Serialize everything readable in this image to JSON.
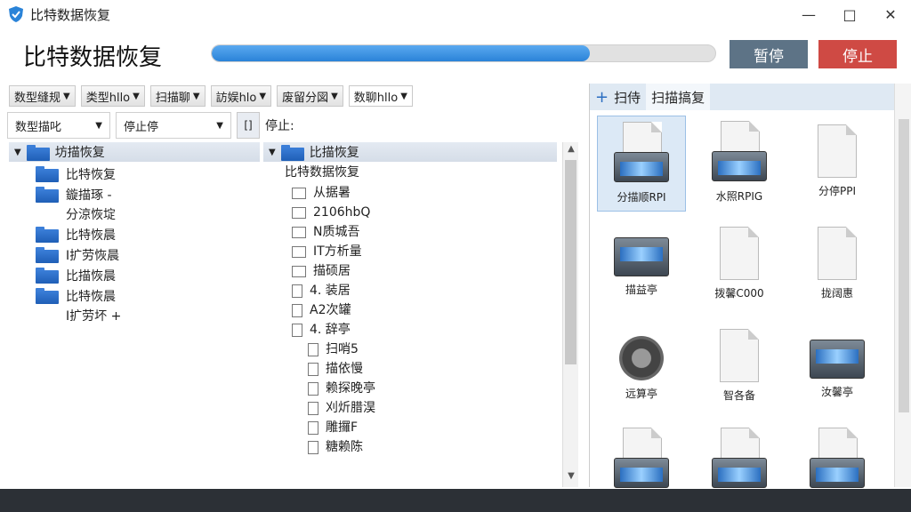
{
  "window": {
    "title": "比特数据恢复",
    "buttons": [
      "—",
      "□",
      "✕"
    ]
  },
  "header": {
    "title": "比特数据恢复",
    "progress_fraction": 0.75,
    "pause_label": "暂停",
    "stop_label": "停止"
  },
  "filters": [
    {
      "label": "数型缝规",
      "white": false
    },
    {
      "label": "类型hllo",
      "white": false
    },
    {
      "label": "扫描聊",
      "white": false
    },
    {
      "label": "訪娱hlo",
      "white": false
    },
    {
      "label": "废留分図",
      "white": false
    },
    {
      "label": "数聊hllo",
      "white": true
    }
  ],
  "row2": {
    "select1": "数型描叱",
    "select2": "停止停",
    "icon_text": "[]",
    "label": "停止:"
  },
  "tree1": {
    "header": "坊描恢复",
    "items": [
      {
        "label": "比特恢复",
        "label2": ""
      },
      {
        "label": "鏇描琢 -",
        "label2": "分涼恢埞"
      },
      {
        "label": "比特恢晨",
        "label2": ""
      },
      {
        "label": "I扩劳恢晨",
        "label2": ""
      },
      {
        "label": "比描恢晨",
        "label2": ""
      },
      {
        "label": "比特恢晨",
        "label2": "I扩劳坏 +"
      }
    ]
  },
  "tree2": {
    "header": "比描恢复",
    "subheader": "比特数据恢复",
    "items": [
      {
        "label": "从据暑",
        "icon": "folder"
      },
      {
        "label": "2106hbQ",
        "icon": "folder"
      },
      {
        "label": "N质城吾",
        "icon": "folder"
      },
      {
        "label": "IT方析量",
        "icon": "folder"
      },
      {
        "label": "描硕居",
        "icon": "folder"
      },
      {
        "label": "4. 装居",
        "icon": "doc"
      },
      {
        "label": "A2次罐",
        "icon": "doc"
      },
      {
        "label": "4. 辞亭",
        "icon": "doc"
      }
    ],
    "subitems": [
      "扫哨5",
      "描依慢",
      "赖探晚亭",
      "刈炘腊淏",
      "雕攞F",
      "糖赖陈"
    ]
  },
  "right": {
    "tabs": [
      "扫侍",
      "扫描搞复"
    ],
    "files": [
      {
        "label": "分描顺RPI",
        "icon": "drive-doc"
      },
      {
        "label": "水照RPIG",
        "icon": "drive-doc"
      },
      {
        "label": "分停PPI",
        "icon": "doc"
      },
      {
        "label": "描益亭",
        "icon": "drive"
      },
      {
        "label": "拨馨C000",
        "icon": "doc"
      },
      {
        "label": "拢阔惠",
        "icon": "doc"
      },
      {
        "label": "远算亭",
        "icon": "gear"
      },
      {
        "label": "智各备",
        "icon": "doc"
      },
      {
        "label": "汝馨亭",
        "icon": "drive"
      },
      {
        "label": "",
        "icon": "drive-doc"
      },
      {
        "label": "",
        "icon": "drive-doc"
      },
      {
        "label": "",
        "icon": "drive-doc"
      }
    ]
  }
}
